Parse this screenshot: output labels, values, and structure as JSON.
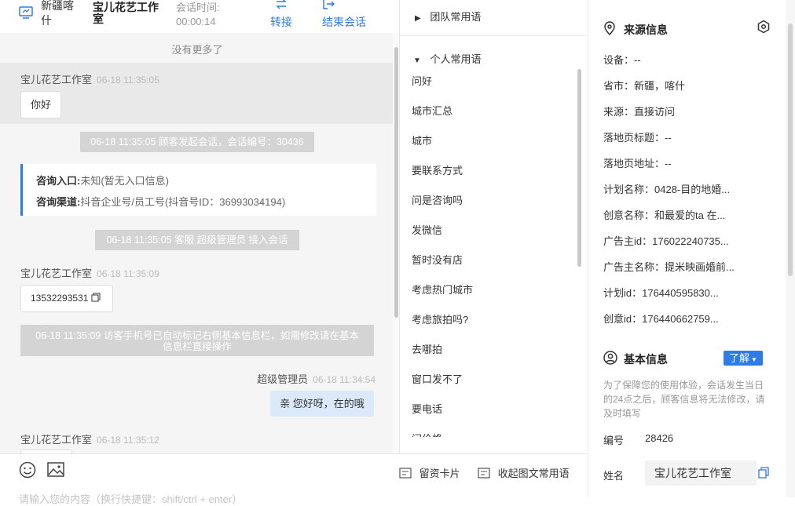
{
  "header": {
    "source": "新疆喀什",
    "customer": "宝儿花艺工作室",
    "time_label": "会话时间:",
    "time_value": "00:00:14",
    "transfer_label": "转接",
    "end_label": "结束会话"
  },
  "chat": {
    "no_more": "没有更多了",
    "messages": [
      {
        "sender": "宝儿花艺工作室",
        "time": "06-18 11:35:05",
        "text": "你好"
      },
      {
        "system": "06-18 11:35:05 顾客发起会话，会话编号：30436"
      },
      {
        "info_entry_key": "咨询入口:",
        "info_entry_val": "未知(暂无入口信息)",
        "info_channel_key": "咨询渠道:",
        "info_channel_val": "抖音企业号/员工号(抖音号ID：36993034194)"
      },
      {
        "system": "06-18 11:35:05 客服 超级管理员 接入会话"
      },
      {
        "sender": "宝儿花艺工作室",
        "time": "06-18 11:35:09",
        "text": "13532293531"
      },
      {
        "system_line1": "06-18 11:35:09 访客手机号已自动标记右侧基本信息栏，如需修改请在基本",
        "system_line2": "信息栏直接操作"
      },
      {
        "sender": "超级管理员",
        "time": "06-18 11:34:54",
        "text": "亲 您好呀，在的哦"
      },
      {
        "sender": "宝儿花艺工作室",
        "time": "06-18 11:35:12"
      }
    ]
  },
  "input": {
    "card_label": "留资卡片",
    "collapse_label": "收起图文常用语",
    "placeholder": "请输入您的内容（换行快捷键：shift/ctrl + enter）"
  },
  "phrases": {
    "team_label": "团队常用语",
    "personal_label": "个人常用语",
    "items": [
      "问好",
      "城市汇总",
      "城市",
      "要联系方式",
      "问是咨询吗",
      "发微信",
      "暂时没有店",
      "考虑热门城市",
      "考虑旅拍吗?",
      "去哪拍",
      "窗口发不了",
      "要电话",
      "问价格"
    ]
  },
  "source_info": {
    "title": "来源信息",
    "rows": [
      "设备：--",
      "省市：新疆，喀什",
      "来源：直接访问",
      "落地页标题：--",
      "落地页地址：--",
      "计划名称：0428-目的地婚...",
      "创意名称：和最爱的ta 在...",
      "广告主id：176022240735...",
      "广告主名称：提米映画婚前...",
      "计划id：176440595830...",
      "创意id：176440662759..."
    ]
  },
  "basic_info": {
    "title": "基本信息",
    "learn_label": "了解",
    "note": [
      "为了保障您的使用体验，会话发生当日",
      "的24点之后，顾客信息将无法修改，请",
      "及时填写"
    ],
    "id_label": "编号",
    "id_value": "28426",
    "name_label": "姓名",
    "name_value": "宝儿花艺工作室"
  },
  "colors": {
    "accent": "#2f7be8",
    "system_bg": "#d4d4d4",
    "agent_bubble": "#dbe9fb"
  }
}
